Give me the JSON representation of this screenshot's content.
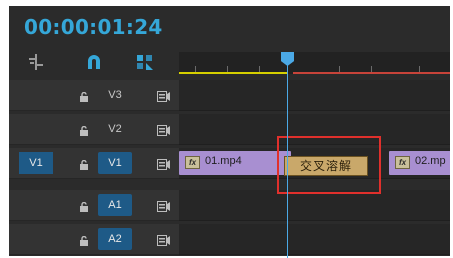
{
  "timecode": "00:00:01:24",
  "toolbar": {
    "icons": [
      "snap-icon",
      "linked-selection-icon",
      "add-marker-icon"
    ],
    "accent": "#35a7d8"
  },
  "tracks": [
    {
      "id": "V3",
      "target": "",
      "target_on": false
    },
    {
      "id": "V2",
      "target": "",
      "target_on": false
    },
    {
      "id": "V1",
      "target": "V1",
      "target_on": true
    },
    {
      "id": "A1",
      "target": "",
      "target_on": false
    },
    {
      "id": "A2",
      "target": "",
      "target_on": false
    }
  ],
  "clips": {
    "clip1": {
      "fx": "fx",
      "name": "01.mp4"
    },
    "clip2": {
      "fx": "fx",
      "name": "02.mp"
    }
  },
  "transition": {
    "name": "交叉溶解"
  },
  "colors": {
    "playhead": "#4ba9e6",
    "clip": "#a88fd1",
    "transition": "#c9a86a",
    "highlight": "#e0302c"
  }
}
